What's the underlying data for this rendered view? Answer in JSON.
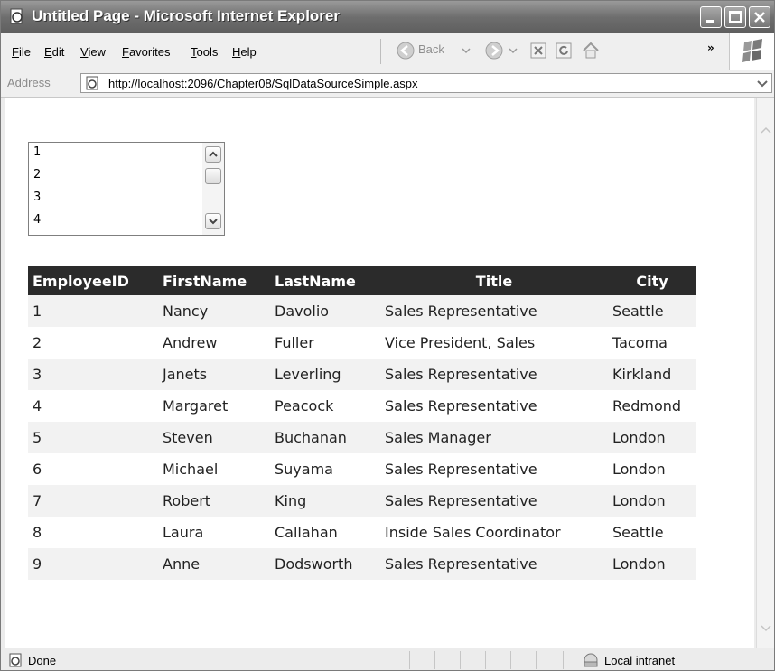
{
  "window": {
    "title": "Untitled Page - Microsoft Internet Explorer"
  },
  "menu": {
    "items": [
      "File",
      "Edit",
      "View",
      "Favorites",
      "Tools",
      "Help"
    ],
    "back_label": "Back",
    "more_chevron": "»"
  },
  "address": {
    "label": "Address",
    "url": "http://localhost:2096/Chapter08/SqlDataSourceSimple.aspx"
  },
  "listbox": {
    "items": [
      "1",
      "2",
      "3",
      "4"
    ]
  },
  "grid": {
    "headers": [
      "EmployeeID",
      "FirstName",
      "LastName",
      "Title",
      "City"
    ],
    "rows": [
      [
        "1",
        "Nancy",
        "Davolio",
        "Sales Representative",
        "Seattle"
      ],
      [
        "2",
        "Andrew",
        "Fuller",
        "Vice President, Sales",
        "Tacoma"
      ],
      [
        "3",
        "Janets",
        "Leverling",
        "Sales Representative",
        "Kirkland"
      ],
      [
        "4",
        "Margaret",
        "Peacock",
        "Sales Representative",
        "Redmond"
      ],
      [
        "5",
        "Steven",
        "Buchanan",
        "Sales Manager",
        "London"
      ],
      [
        "6",
        "Michael",
        "Suyama",
        "Sales Representative",
        "London"
      ],
      [
        "7",
        "Robert",
        "King",
        "Sales Representative",
        "London"
      ],
      [
        "8",
        "Laura",
        "Callahan",
        "Inside Sales Coordinator",
        "Seattle"
      ],
      [
        "9",
        "Anne",
        "Dodsworth",
        "Sales Representative",
        "London"
      ]
    ]
  },
  "status": {
    "text": "Done",
    "zone": "Local intranet"
  }
}
